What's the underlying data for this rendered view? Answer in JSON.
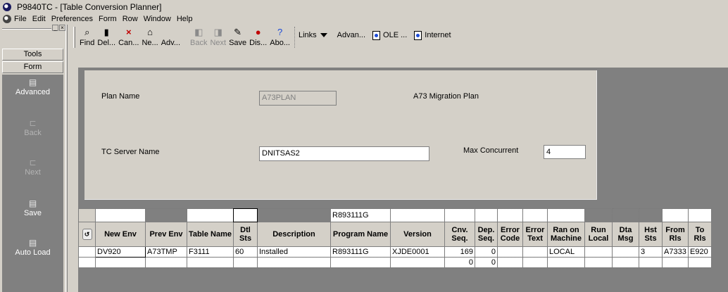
{
  "window": {
    "title": "P9840TC - [Table Conversion Planner]"
  },
  "menu": [
    "File",
    "Edit",
    "Preferences",
    "Form",
    "Row",
    "Window",
    "Help"
  ],
  "sidebar": {
    "tabs": [
      "Tools",
      "Form"
    ],
    "buttons": [
      {
        "label": "Advanced",
        "icon": "save-doc-icon",
        "enabled": true
      },
      {
        "label": "Back",
        "icon": "back-icon",
        "enabled": false
      },
      {
        "label": "Next",
        "icon": "next-icon",
        "enabled": false
      },
      {
        "label": "Save",
        "icon": "save-doc-icon",
        "enabled": true
      },
      {
        "label": "Auto Load",
        "icon": "save-doc-icon",
        "enabled": true
      }
    ]
  },
  "toolbar": {
    "buttons": [
      {
        "label": "Find",
        "icon": "find-icon",
        "enabled": true
      },
      {
        "label": "Del...",
        "icon": "trash-icon",
        "enabled": true
      },
      {
        "label": "Can...",
        "icon": "close-icon",
        "enabled": true
      },
      {
        "label": "Ne...",
        "icon": "new-icon",
        "enabled": true
      },
      {
        "label": "Adv...",
        "icon": "advanced-icon",
        "enabled": true
      },
      {
        "label": "Back",
        "icon": "back-icon",
        "enabled": false
      },
      {
        "label": "Next",
        "icon": "next-icon",
        "enabled": false
      },
      {
        "label": "Save",
        "icon": "save-icon",
        "enabled": true
      },
      {
        "label": "Dis...",
        "icon": "display-icon",
        "enabled": true
      },
      {
        "label": "Abo...",
        "icon": "about-icon",
        "enabled": true
      }
    ],
    "links": {
      "links_label": "Links",
      "advan_label": "Advan...",
      "ole_label": "OLE ...",
      "internet_label": "Internet"
    }
  },
  "form": {
    "plan_name_label": "Plan Name",
    "plan_name_value": "A73PLAN",
    "plan_desc": "A73  Migration Plan",
    "tc_server_label": "TC Server Name",
    "tc_server_value": "DNITSAS2",
    "max_concurrent_label": "Max Concurrent",
    "max_concurrent_value": "4"
  },
  "grid": {
    "qbe": [
      "",
      "",
      "",
      "",
      "",
      "R893111G",
      "",
      "",
      "",
      "",
      "",
      "",
      "",
      "",
      "",
      "",
      "",
      ""
    ],
    "columns": [
      "New Env",
      "Prev Env",
      "Table Name",
      "Dtl Sts",
      "Description",
      "Program Name",
      "Version",
      "Cnv. Seq.",
      "Dep. Seq.",
      "Error Code",
      "Error Text",
      "Ran on Machine",
      "Run Local",
      "Dta Msg",
      "Hst Sts",
      "From Rls",
      "To Rls"
    ],
    "rows": [
      [
        "DV920",
        "A73TMP",
        "F3111",
        "60",
        "Installed",
        "R893111G",
        "XJDE0001",
        "169",
        "0",
        "",
        "",
        "LOCAL",
        "",
        "",
        "3",
        "A7333",
        "E920"
      ],
      [
        "",
        "",
        "",
        "",
        "",
        "",
        "",
        "0",
        "0",
        "",
        "",
        "",
        "",
        "",
        "",
        "",
        ""
      ]
    ]
  }
}
